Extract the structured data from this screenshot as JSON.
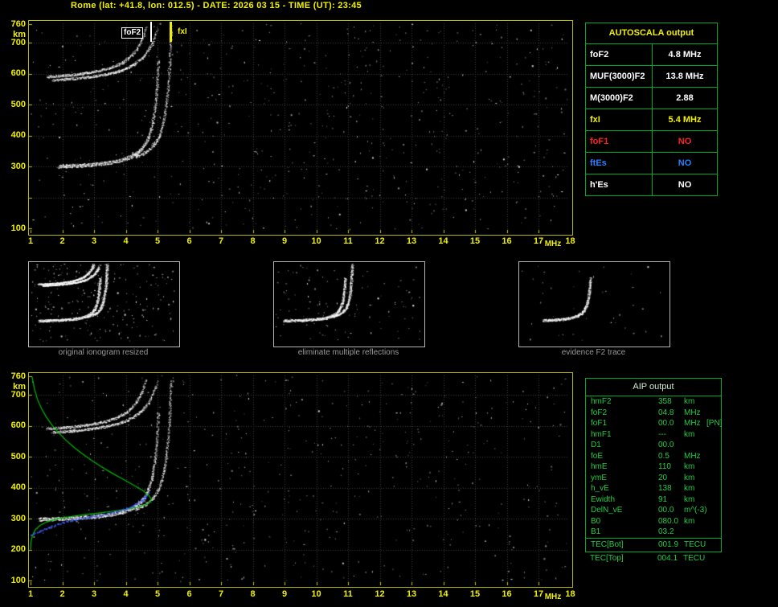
{
  "title": "Rome (lat: +41.8, lon: 012.5) - DATE: 2026 03 15 - TIME (UT): 23:45",
  "colors": {
    "axis_yellow": "#f0f000",
    "panel_green": "#00aa22",
    "aip_text_green": "#22cc44",
    "trace_white": "#ffffff",
    "profile_green": "#00bb00",
    "fitted_blue": "#3d5cff"
  },
  "autoscala": {
    "header": "AUTOSCALA output",
    "rows": [
      {
        "label": "foF2",
        "value": "4.8 MHz",
        "color": "#ffffff"
      },
      {
        "label": "MUF(3000)F2",
        "value": "13.8 MHz",
        "color": "#ffffff"
      },
      {
        "label": "M(3000)F2",
        "value": "2.88",
        "color": "#ffffff"
      },
      {
        "label": "fxI",
        "value": "5.4 MHz",
        "color": "#f0f000"
      },
      {
        "label": "foF1",
        "value": "NO",
        "color": "#ff2222"
      },
      {
        "label": "ftEs",
        "value": "NO",
        "color": "#2a7fff"
      },
      {
        "label": "h'Es",
        "value": "NO",
        "color": "#ffffff"
      }
    ]
  },
  "thumbnails": [
    {
      "caption": "original ionogram resized"
    },
    {
      "caption": "eliminate multiple reflections"
    },
    {
      "caption": "evidence F2 trace"
    }
  ],
  "aip": {
    "header": "AIP output",
    "rows": [
      {
        "label": "hmF2",
        "value": "358",
        "unit": "km",
        "extra": ""
      },
      {
        "label": "foF2",
        "value": "04.8",
        "unit": "MHz",
        "extra": ""
      },
      {
        "label": "foF1",
        "value": "00.0",
        "unit": "MHz",
        "extra": "[PN]"
      },
      {
        "label": "hmF1",
        "value": "---",
        "unit": "km",
        "extra": ""
      },
      {
        "label": "D1",
        "value": "00.0",
        "unit": "",
        "extra": ""
      },
      {
        "label": "foE",
        "value": "0.5",
        "unit": "MHz",
        "extra": ""
      },
      {
        "label": "hmE",
        "value": "110",
        "unit": "km",
        "extra": ""
      },
      {
        "label": "ymE",
        "value": "20",
        "unit": "km",
        "extra": ""
      },
      {
        "label": "h_vE",
        "value": "138",
        "unit": "km",
        "extra": ""
      },
      {
        "label": "Ewidth",
        "value": "91",
        "unit": "km",
        "extra": ""
      },
      {
        "label": "DelN_vE",
        "value": "00.0",
        "unit": "m^(-3)",
        "extra": ""
      },
      {
        "label": "B0",
        "value": "080.0",
        "unit": "km",
        "extra": ""
      },
      {
        "label": "B1",
        "value": "03.2",
        "unit": "",
        "extra": ""
      }
    ],
    "tec_rows": [
      {
        "label": "TEC[Bot]",
        "value": "001.9",
        "unit": "TECU"
      },
      {
        "label": "TEC[Top]",
        "value": "004.1",
        "unit": "TECU"
      }
    ]
  },
  "chart_data": {
    "type": "scatter",
    "title": "Ionogram with AUTOSCALA scaling and AIP electron density profile",
    "x_axis": {
      "label": "MHz",
      "range": [
        1,
        18
      ],
      "ticks": [
        1,
        2,
        3,
        4,
        5,
        6,
        7,
        8,
        9,
        10,
        11,
        12,
        13,
        14,
        15,
        16,
        17,
        18
      ]
    },
    "y_axis": {
      "unit": "km",
      "range": [
        100,
        760
      ]
    },
    "top_plot": {
      "y_tick_labels": [
        760,
        700,
        600,
        500,
        400,
        300,
        100
      ],
      "markers": [
        {
          "name": "foF2",
          "freq_mhz": 4.8,
          "color": "#ffffff"
        },
        {
          "name": "fxI",
          "freq_mhz": 5.4,
          "color": "#f0f000"
        }
      ]
    },
    "bottom_plot": {
      "y_tick_labels": [
        760,
        700,
        600,
        500,
        400,
        300,
        200,
        100
      ],
      "profile_points_f_h": [
        [
          1.05,
          758
        ],
        [
          1.12,
          720
        ],
        [
          1.22,
          685
        ],
        [
          1.35,
          655
        ],
        [
          1.5,
          628
        ],
        [
          1.68,
          602
        ],
        [
          1.88,
          578
        ],
        [
          2.1,
          555
        ],
        [
          2.35,
          532
        ],
        [
          2.6,
          512
        ],
        [
          2.9,
          490
        ],
        [
          3.2,
          470
        ],
        [
          3.55,
          448
        ],
        [
          3.9,
          428
        ],
        [
          4.25,
          408
        ],
        [
          4.55,
          390
        ],
        [
          4.72,
          376
        ],
        [
          4.8,
          364
        ],
        [
          4.78,
          356
        ],
        [
          4.65,
          346
        ],
        [
          4.4,
          338
        ],
        [
          4.05,
          331
        ],
        [
          3.65,
          325
        ],
        [
          3.2,
          319
        ],
        [
          2.7,
          313
        ],
        [
          2.2,
          306
        ],
        [
          1.8,
          298
        ],
        [
          1.5,
          289
        ],
        [
          1.3,
          278
        ],
        [
          1.15,
          264
        ],
        [
          1.06,
          246
        ],
        [
          1.01,
          222
        ],
        [
          1.0,
          200
        ]
      ],
      "fitted_points_f_h": [
        [
          1.0,
          248
        ],
        [
          1.3,
          262
        ],
        [
          1.6,
          274
        ],
        [
          2.0,
          289
        ],
        [
          2.4,
          299
        ],
        [
          2.8,
          306
        ],
        [
          3.2,
          313
        ],
        [
          3.6,
          322
        ],
        [
          4.0,
          334
        ],
        [
          4.3,
          347
        ],
        [
          4.5,
          360
        ],
        [
          4.62,
          372
        ],
        [
          4.7,
          385
        ]
      ]
    },
    "trace_model": {
      "o_trace": {
        "fc": 5.2,
        "base": 290,
        "A": 8,
        "p": 1.2
      },
      "x_trace": {
        "fc": 5.58,
        "base": 295,
        "A": 8,
        "p": 1.2
      },
      "second_hop": true
    },
    "scaled_values": {
      "foF2_mhz": 4.8,
      "fxI_mhz": 5.4,
      "MUF3000F2_mhz": 13.8,
      "M3000F2": 2.88,
      "hmF2_km": 358,
      "foE_mhz": 0.5,
      "hmE_km": 110
    }
  }
}
